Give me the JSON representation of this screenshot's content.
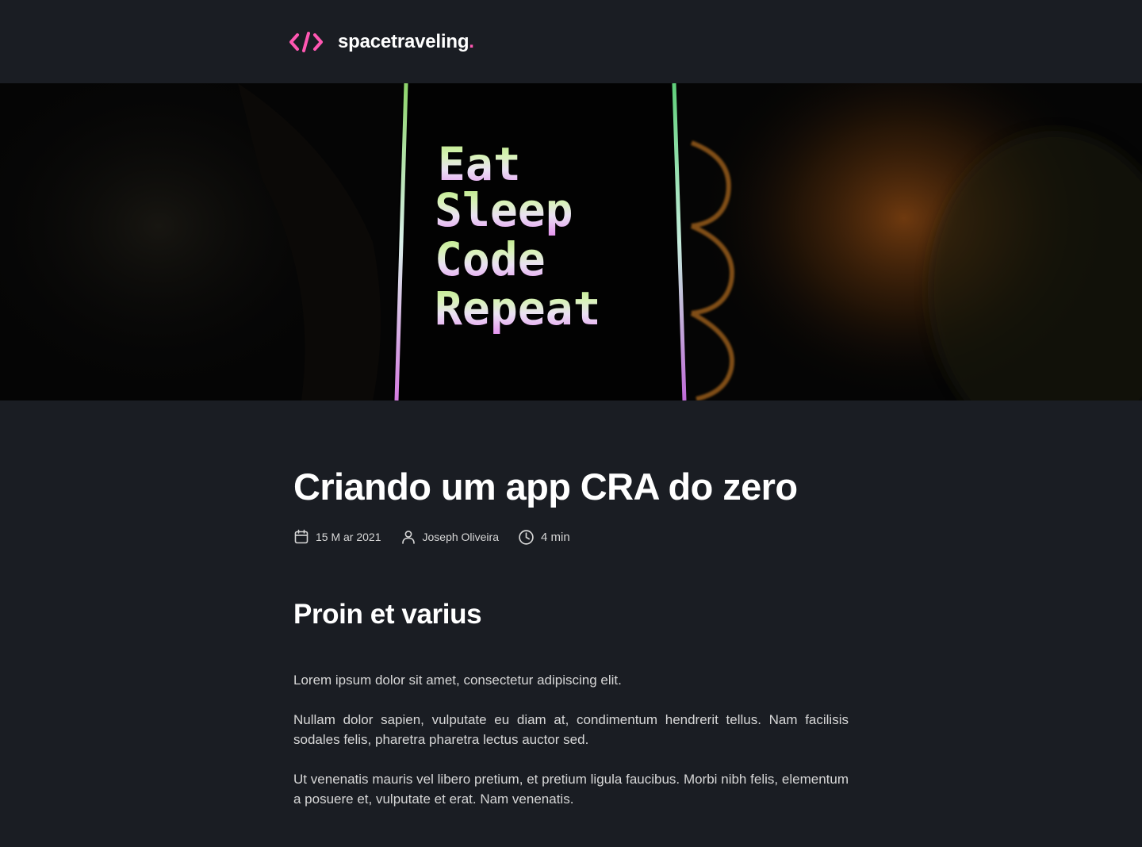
{
  "header": {
    "brand_name": "spacetraveling",
    "brand_dot": ".",
    "logo_icon": "code-brackets-icon",
    "accent_color": "#ff57b2"
  },
  "banner": {
    "lines": [
      "Eat",
      "Sleep",
      "Code",
      "Repeat"
    ]
  },
  "post": {
    "title": "Criando um app CRA do zero",
    "date": "15 M ar 2021",
    "author": "Joseph Oliveira",
    "reading_time": "4 min",
    "icons": [
      "calendar-icon",
      "user-icon",
      "clock-icon"
    ],
    "section_heading": "Proin et varius",
    "paragraphs": [
      "Lorem ipsum dolor sit amet, consectetur adipiscing elit.",
      "Nullam dolor sapien, vulputate eu diam at, condimentum hendrerit tellus. Nam facilisis sodales felis, pharetra pharetra lectus auctor sed.",
      "Ut venenatis mauris vel libero pretium, et pretium ligula faucibus. Morbi nibh felis, elementum a posuere et, vulputate et erat. Nam venenatis."
    ]
  }
}
